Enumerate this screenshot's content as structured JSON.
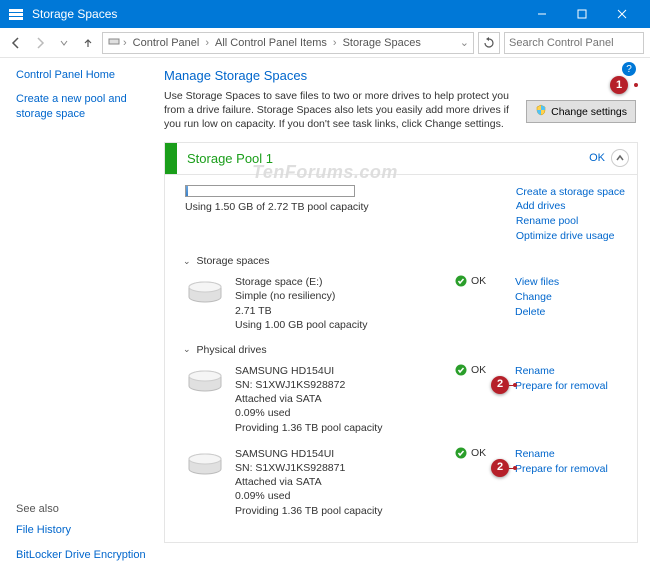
{
  "window": {
    "title": "Storage Spaces"
  },
  "breadcrumb": {
    "items": [
      "Control Panel",
      "All Control Panel Items",
      "Storage Spaces"
    ]
  },
  "search": {
    "placeholder": "Search Control Panel"
  },
  "sidebar": {
    "home": "Control Panel Home",
    "create_pool": "Create a new pool and storage space",
    "see_also": "See also",
    "file_history": "File History",
    "bitlocker": "BitLocker Drive Encryption"
  },
  "main": {
    "heading": "Manage Storage Spaces",
    "intro": "Use Storage Spaces to save files to two or more drives to help protect you from a drive failure. Storage Spaces also lets you easily add more drives if you run low on capacity. If you don't see task links, click Change settings.",
    "change_settings": "Change settings"
  },
  "pool": {
    "name": "Storage Pool 1",
    "status": "OK",
    "capacity_text": "Using 1.50 GB of 2.72 TB pool capacity",
    "links": {
      "create": "Create a storage space",
      "add": "Add drives",
      "rename": "Rename pool",
      "optimize": "Optimize drive usage"
    },
    "sections": {
      "spaces": "Storage spaces",
      "drives": "Physical drives"
    },
    "space": {
      "name": "Storage space (E:)",
      "resiliency": "Simple (no resiliency)",
      "size": "2.71 TB",
      "usage": "Using 1.00 GB pool capacity",
      "status": "OK",
      "links": {
        "view": "View files",
        "change": "Change",
        "delete": "Delete"
      }
    },
    "drives": [
      {
        "model": "SAMSUNG HD154UI",
        "sn": "SN: S1XWJ1KS928872",
        "attached": "Attached via SATA",
        "used": "0.09% used",
        "providing": "Providing 1.36 TB pool capacity",
        "status": "OK",
        "links": {
          "rename": "Rename",
          "prepare": "Prepare for removal"
        }
      },
      {
        "model": "SAMSUNG HD154UI",
        "sn": "SN: S1XWJ1KS928871",
        "attached": "Attached via SATA",
        "used": "0.09% used",
        "providing": "Providing 1.36 TB pool capacity",
        "status": "OK",
        "links": {
          "rename": "Rename",
          "prepare": "Prepare for removal"
        }
      }
    ]
  },
  "watermark": "TenForums.com",
  "badges": {
    "one": "1",
    "two": "2"
  }
}
